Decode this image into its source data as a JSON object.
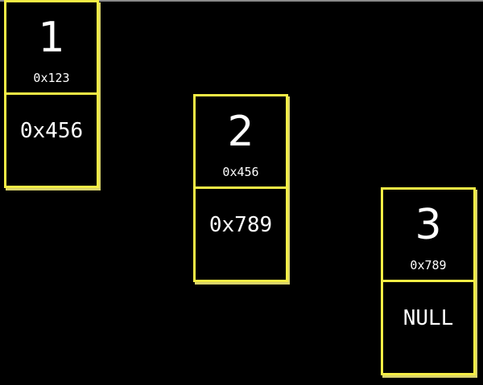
{
  "colors": {
    "background": "#000000",
    "node_border": "#f5ee45",
    "text": "#ffffff"
  },
  "nodes": [
    {
      "value": "1",
      "address": "0x123",
      "next": "0x456"
    },
    {
      "value": "2",
      "address": "0x456",
      "next": "0x789"
    },
    {
      "value": "3",
      "address": "0x789",
      "next": "NULL"
    }
  ]
}
